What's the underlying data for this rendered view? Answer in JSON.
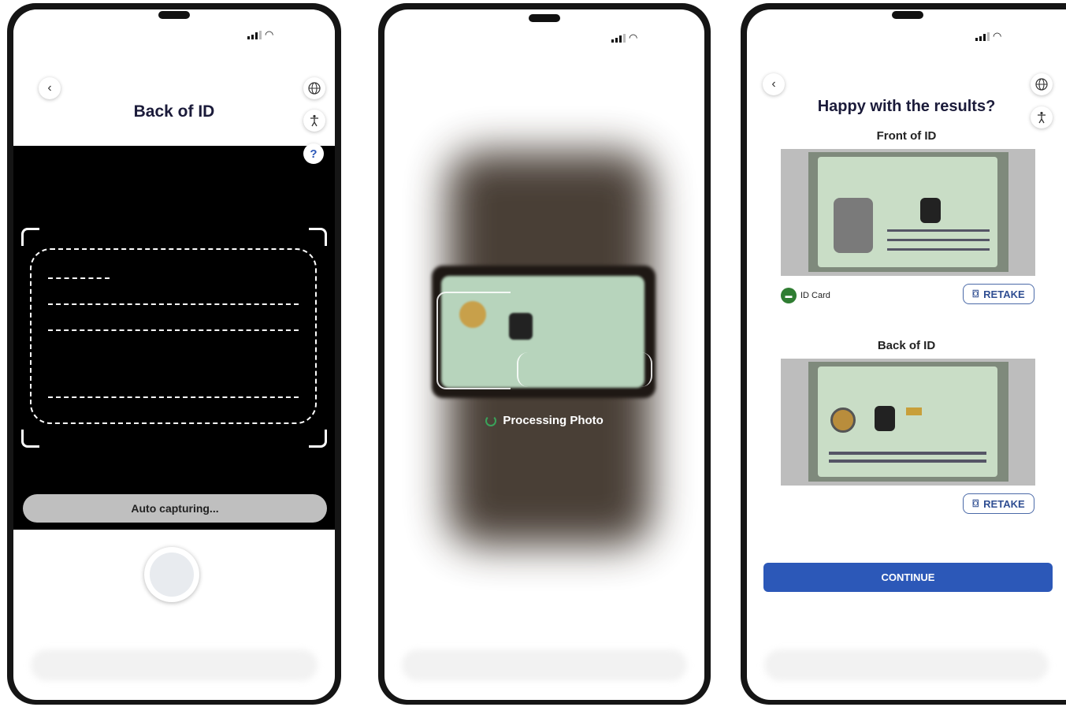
{
  "screens": [
    {
      "title": "Back of ID",
      "status_bar": {
        "signal_icon": "signal-bars-icon",
        "wifi_icon": "wifi-icon"
      },
      "buttons": {
        "back_icon": "‹",
        "globe_icon": "🌐",
        "accessibility_icon": "🚶",
        "help_icon": "?"
      },
      "status_pill": "Auto capturing..."
    },
    {
      "processing_label": "Processing Photo"
    },
    {
      "title": "Happy with the results?",
      "front_label": "Front of ID",
      "back_label": "Back of ID",
      "document_type": "ID Card",
      "retake_label": "RETAKE",
      "continue_label": "CONTINUE"
    }
  ],
  "colors": {
    "primary": "#2c58b8",
    "retake_border": "#4b6aa8",
    "camera_bg": "#000000",
    "pill_bg": "#bfbfbf"
  }
}
